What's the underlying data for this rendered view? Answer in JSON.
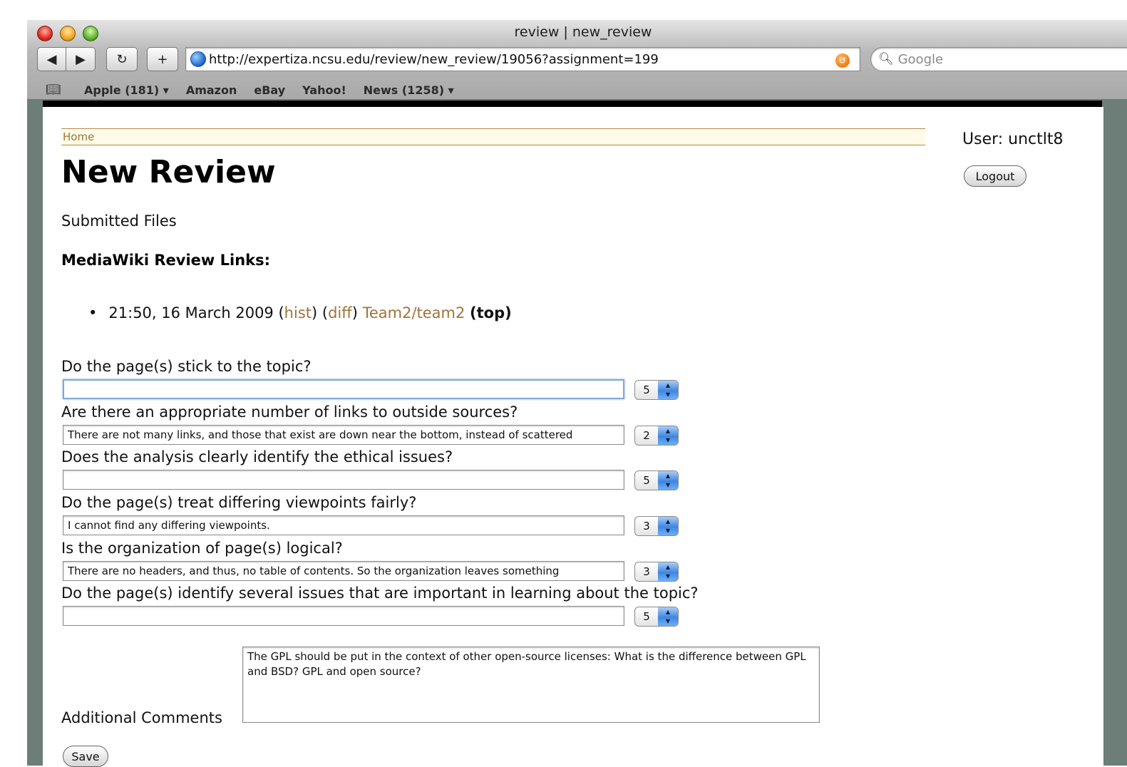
{
  "browser": {
    "window_title": "review | new_review",
    "url": "http://expertiza.ncsu.edu/review/new_review/19056?assignment=199",
    "search_placeholder": "Google",
    "bookmarks": [
      "Apple (181) ▾",
      "Amazon",
      "eBay",
      "Yahoo!",
      "News (1258) ▾"
    ]
  },
  "page": {
    "breadcrumb_home": "Home",
    "user_label": "User: unctlt8",
    "logout_label": "Logout",
    "title": "New Review",
    "submitted_files": "Submitted Files",
    "mediawiki_heading": "MediaWiki Review Links:",
    "revision": {
      "timestamp": "21:50, 16 March 2009",
      "hist": "hist",
      "diff": "diff",
      "page": "Team2/team2",
      "tag": "(top)"
    },
    "questions": [
      {
        "label": "Do the page(s) stick to the topic?",
        "comment": "",
        "score": "5"
      },
      {
        "label": "Are there an appropriate number of links to outside sources?",
        "comment": "There are not many links, and those that exist are down near the bottom, instead of scattered",
        "score": "2"
      },
      {
        "label": "Does the analysis clearly identify the ethical issues?",
        "comment": "",
        "score": "5"
      },
      {
        "label": "Do the page(s) treat differing viewpoints fairly?",
        "comment": "I cannot find any differing viewpoints.",
        "score": "3"
      },
      {
        "label": "Is the organization of page(s) logical?",
        "comment": "There are no headers, and thus, no table of contents.  So the organization leaves something",
        "score": "3"
      },
      {
        "label": "Do the page(s) identify several issues that are important in learning about the topic?",
        "comment": "",
        "score": "5"
      }
    ],
    "additional_comments_label": "Additional Comments",
    "additional_comments": "The GPL should be put in the context of other open-source licenses: What is the difference between GPL and BSD?  GPL and open source?",
    "save_label": "Save"
  }
}
